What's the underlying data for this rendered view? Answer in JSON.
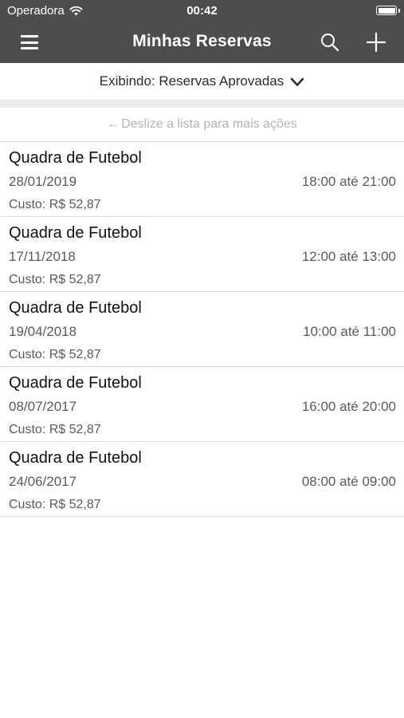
{
  "status_bar": {
    "carrier": "Operadora",
    "time": "00:42"
  },
  "nav": {
    "title": "Minhas Reservas",
    "icons": [
      "menu-icon",
      "search-icon",
      "plus-icon"
    ]
  },
  "filter": {
    "label": "Exibindo: Reservas Aprovadas",
    "icon": "chevron-down-icon"
  },
  "hint": {
    "arrow": "←",
    "text": "Deslize a lista para mais ações"
  },
  "reservations": [
    {
      "title": "Quadra de Futebol",
      "date": "28/01/2019",
      "time": "18:00 até 21:00",
      "cost": "Custo: R$ 52,87"
    },
    {
      "title": "Quadra de Futebol",
      "date": "17/11/2018",
      "time": "12:00 até 13:00",
      "cost": "Custo: R$ 52,87"
    },
    {
      "title": "Quadra de Futebol",
      "date": "19/04/2018",
      "time": "10:00 até 11:00",
      "cost": "Custo: R$ 52,87"
    },
    {
      "title": "Quadra de Futebol",
      "date": "08/07/2017",
      "time": "16:00 até 20:00",
      "cost": "Custo: R$ 52,87"
    },
    {
      "title": "Quadra de Futebol",
      "date": "24/06/2017",
      "time": "08:00 até 09:00",
      "cost": "Custo: R$ 52,87"
    }
  ],
  "colors": {
    "header_bg": "#4d4d4d",
    "header_text": "#ffffff",
    "band": "#ececee",
    "hint_text": "#b3b3b3",
    "secondary_text": "#5a5a5a"
  }
}
